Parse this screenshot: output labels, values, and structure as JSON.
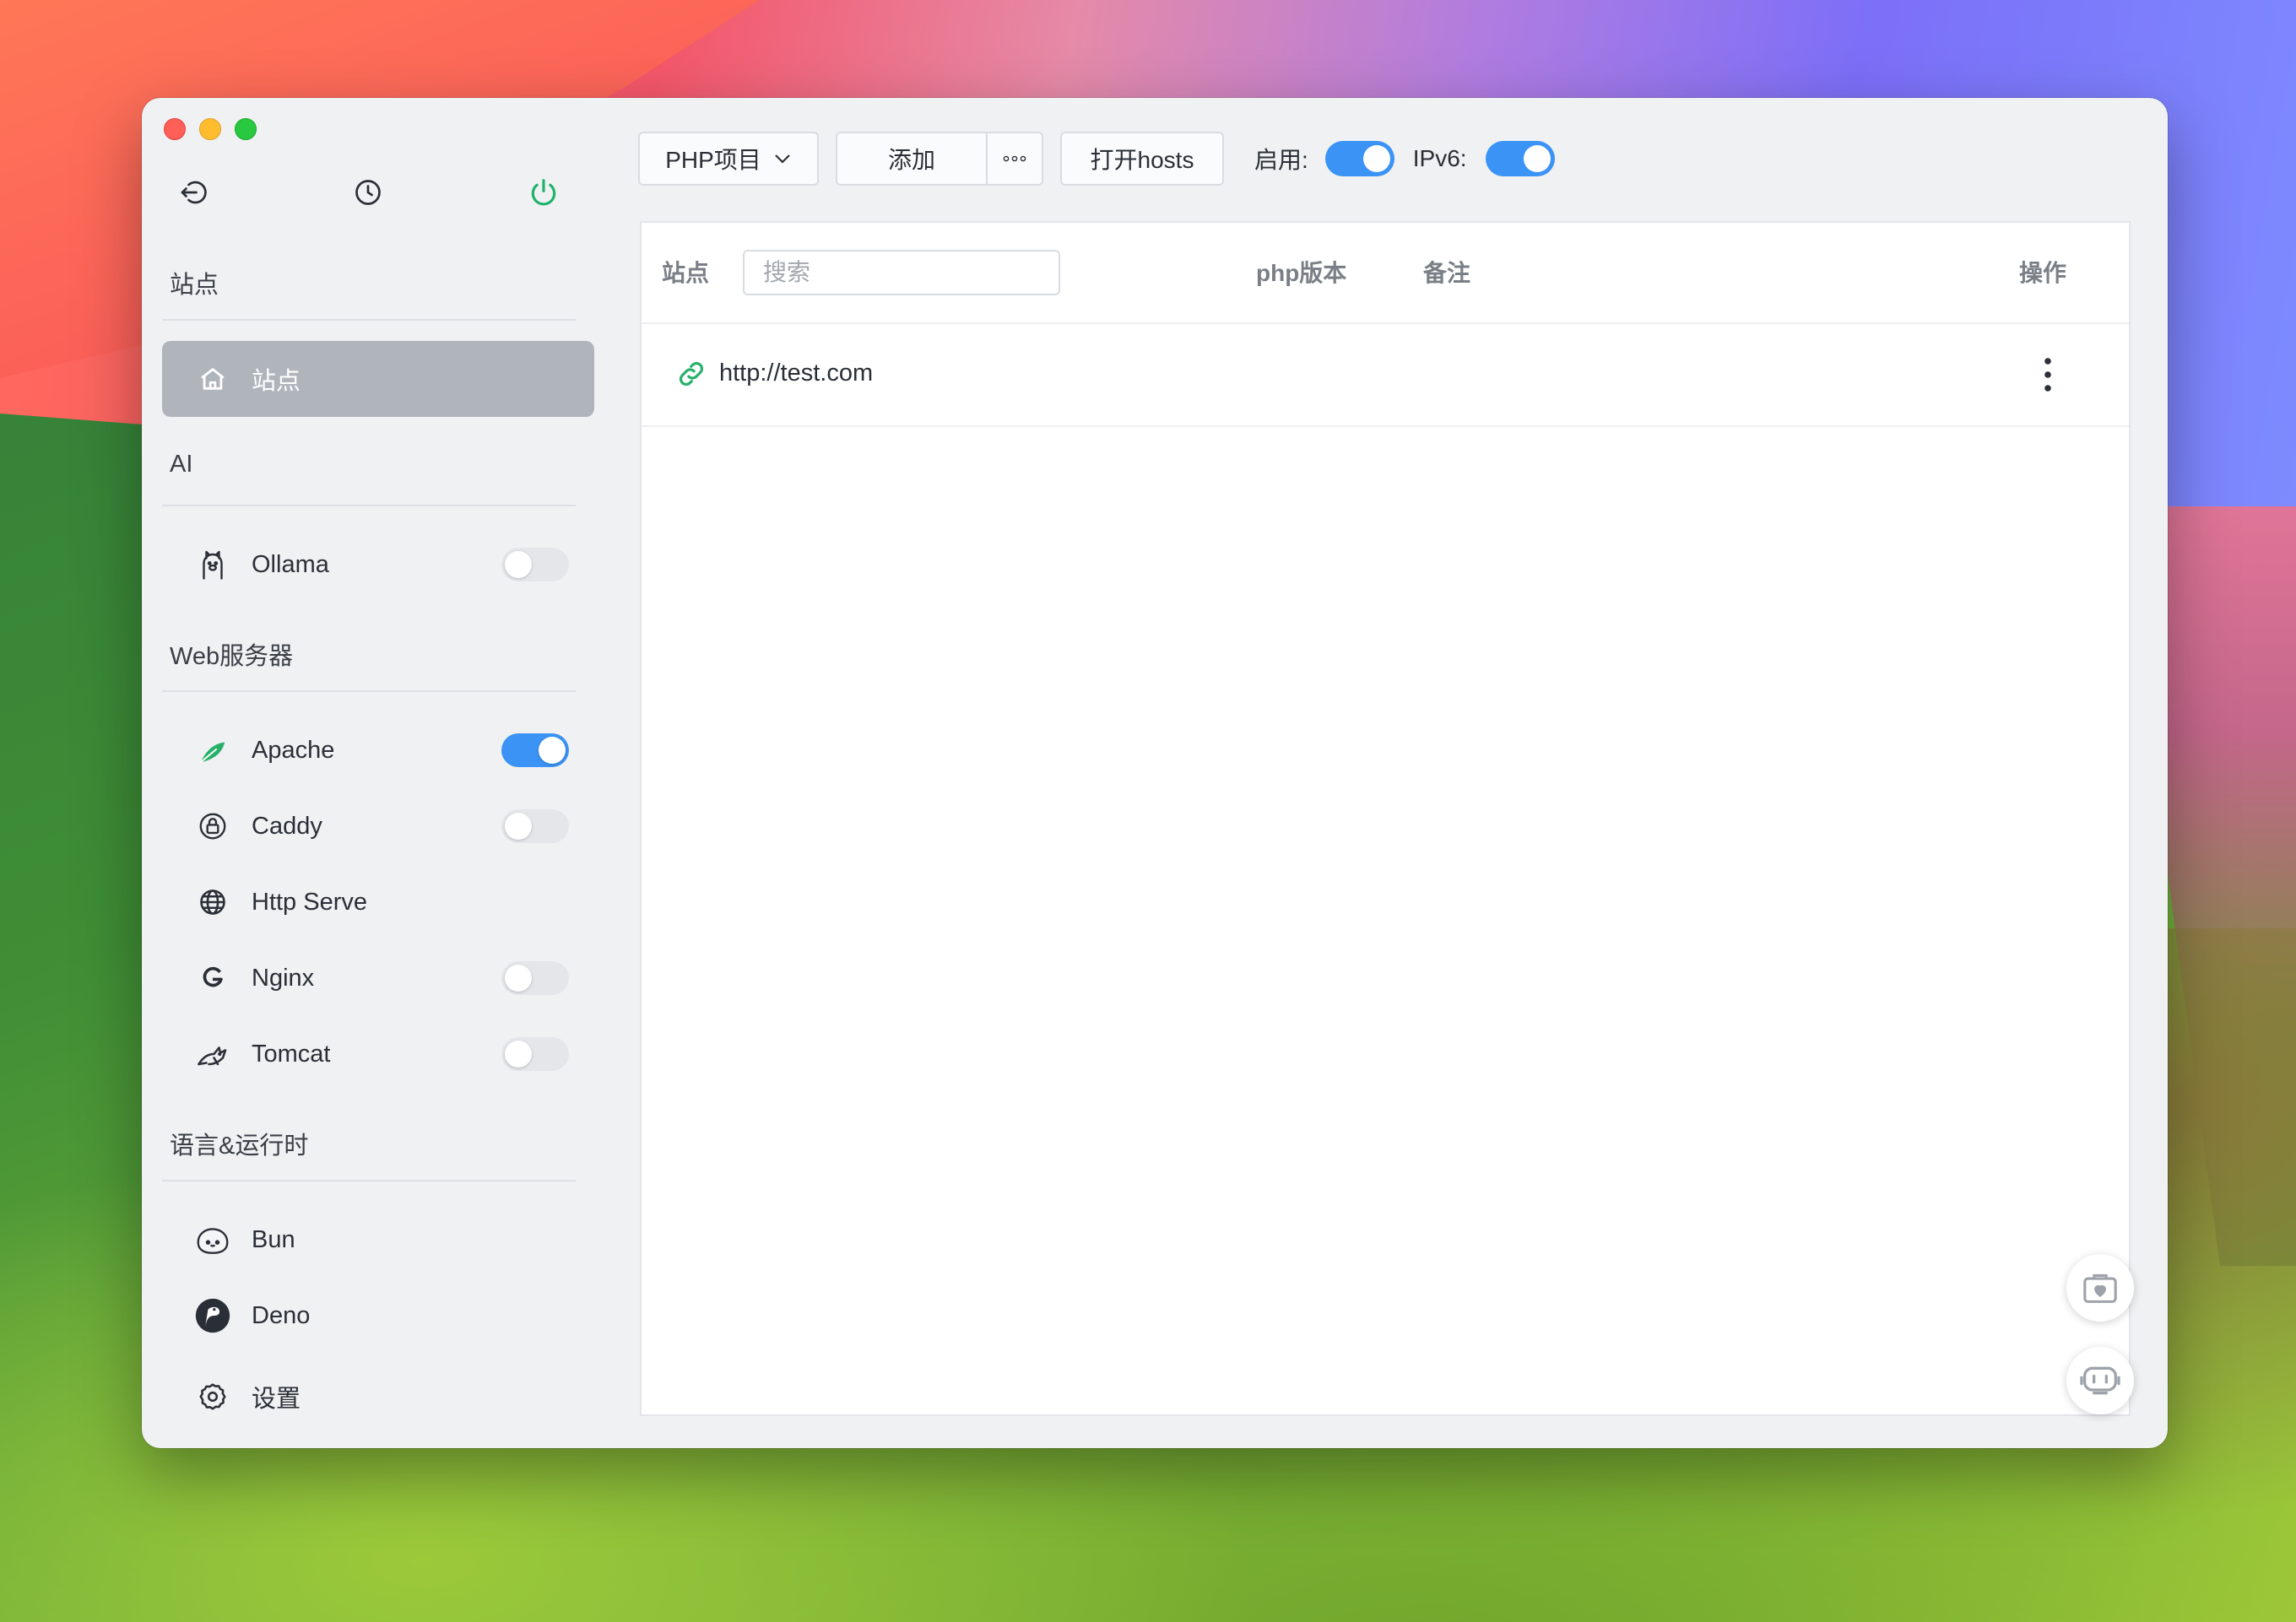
{
  "window": {
    "traffic_lights": [
      "close",
      "minimize",
      "zoom"
    ]
  },
  "sidebar": {
    "top_icons": [
      "back-icon",
      "clock-icon",
      "power-icon"
    ],
    "sections": {
      "sites": "站点",
      "ai": "AI",
      "web": "Web服务器",
      "lang": "语言&运行时"
    },
    "items": {
      "site": {
        "label": "站点",
        "icon": "home-icon",
        "active": true
      },
      "ollama": {
        "label": "Ollama",
        "icon": "llama-icon",
        "enabled": false
      },
      "apache": {
        "label": "Apache",
        "icon": "feather-icon",
        "enabled": true
      },
      "caddy": {
        "label": "Caddy",
        "icon": "caddy-icon",
        "enabled": false
      },
      "http": {
        "label": "Http Serve",
        "icon": "globe-icon"
      },
      "nginx": {
        "label": "Nginx",
        "icon": "nginx-icon",
        "enabled": false
      },
      "tomcat": {
        "label": "Tomcat",
        "icon": "cat-icon",
        "enabled": false
      },
      "bun": {
        "label": "Bun",
        "icon": "bun-icon"
      },
      "deno": {
        "label": "Deno",
        "icon": "deno-icon"
      },
      "settings": {
        "label": "设置",
        "icon": "gear-icon"
      }
    }
  },
  "toolbar": {
    "project_type": "PHP项目",
    "add": "添加",
    "more": "···",
    "open_hosts": "打开hosts",
    "enable_label": "启用:",
    "enable_on": true,
    "ipv6_label": "IPv6:",
    "ipv6_on": true
  },
  "table": {
    "headers": {
      "site": "站点",
      "php": "php版本",
      "note": "备注",
      "action": "操作"
    },
    "search_placeholder": "搜索",
    "rows": [
      {
        "url": "http://test.com",
        "php": "",
        "note": ""
      }
    ]
  },
  "colors": {
    "accent": "#3b93f5",
    "active_bg": "#b0b5bc",
    "power_green": "#1fb36b",
    "link_green": "#28b06a"
  }
}
